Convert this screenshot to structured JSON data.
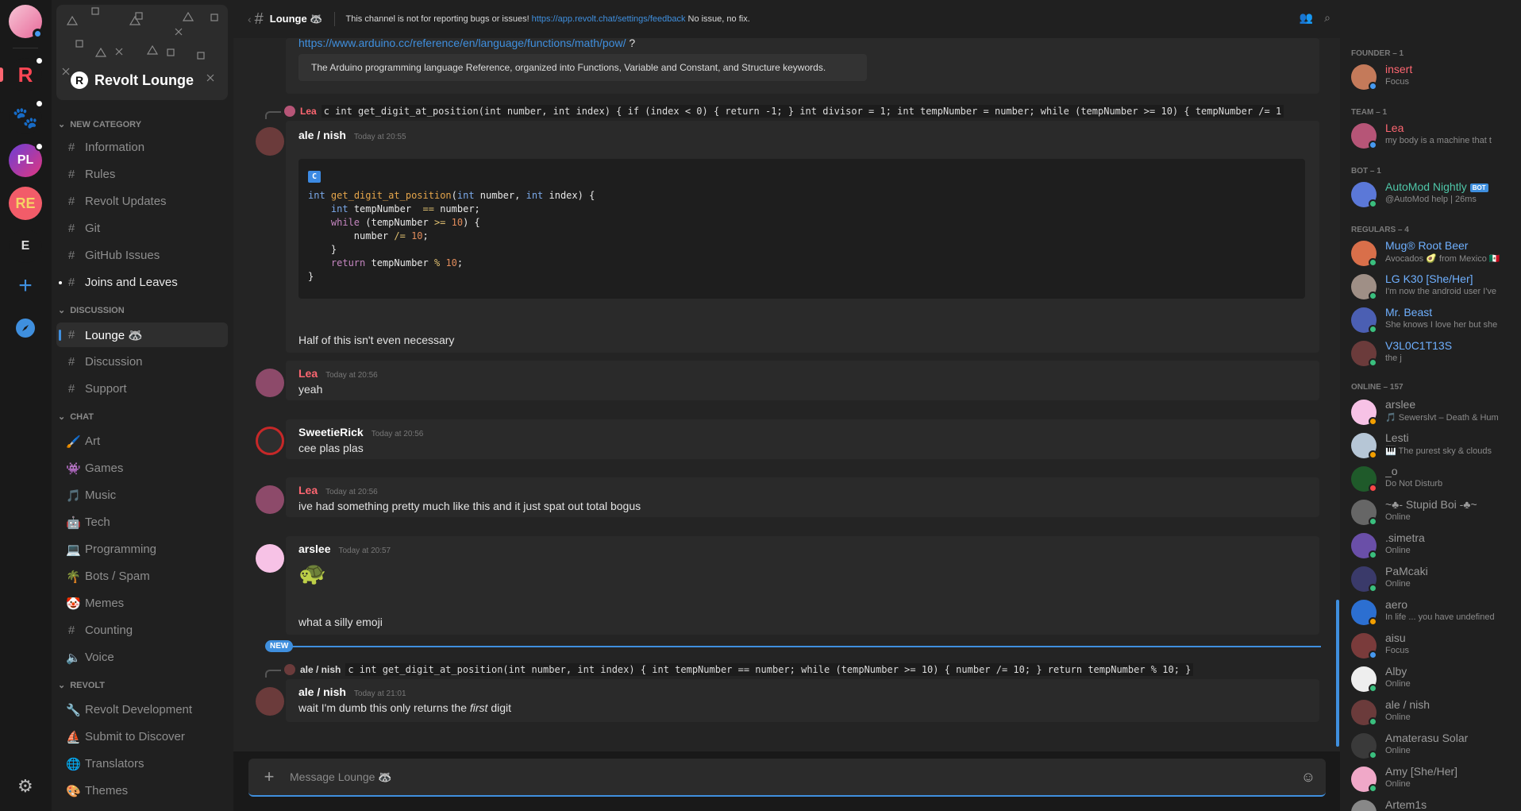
{
  "colors": {
    "accent": "#3f8fde",
    "danger": "#fd6671",
    "online": "#3abf7e",
    "idle": "#f39f00",
    "dnd": "#f84848",
    "focus": "#4799f0"
  },
  "servers": [
    {
      "name": "user-avatar",
      "letter": ""
    },
    {
      "name": "revolt",
      "letter": "R"
    },
    {
      "name": "paw",
      "letter": "🐾"
    },
    {
      "name": "pl",
      "letter": "PL"
    },
    {
      "name": "re",
      "letter": "RE"
    },
    {
      "name": "e",
      "letter": "E"
    }
  ],
  "sidebar": {
    "server_name": "Revolt Lounge",
    "categories": [
      {
        "label": "NEW CATEGORY"
      },
      {
        "label": "DISCUSSION"
      },
      {
        "label": "CHAT"
      },
      {
        "label": "REVOLT"
      }
    ],
    "channels": [
      {
        "label": "Information",
        "icon": "#"
      },
      {
        "label": "Rules",
        "icon": "#"
      },
      {
        "label": "Revolt Updates",
        "icon": "#"
      },
      {
        "label": "Git",
        "icon": "#"
      },
      {
        "label": "GitHub Issues",
        "icon": "#"
      },
      {
        "label": "Joins and Leaves",
        "icon": "#"
      },
      {
        "label": "Lounge 🦝",
        "icon": "#"
      },
      {
        "label": "Discussion",
        "icon": "#"
      },
      {
        "label": "Support",
        "icon": "#"
      },
      {
        "label": "Art",
        "icon": "🖌️"
      },
      {
        "label": "Games",
        "icon": "👾"
      },
      {
        "label": "Music",
        "icon": "🎵"
      },
      {
        "label": "Tech",
        "icon": "🤖"
      },
      {
        "label": "Programming",
        "icon": "💻"
      },
      {
        "label": "Bots / Spam",
        "icon": "🌴"
      },
      {
        "label": "Memes",
        "icon": "🤡"
      },
      {
        "label": "Counting",
        "icon": "#"
      },
      {
        "label": "Voice",
        "icon": "🔈"
      },
      {
        "label": "Revolt Development",
        "icon": "🔧"
      },
      {
        "label": "Submit to Discover",
        "icon": "⛵"
      },
      {
        "label": "Translators",
        "icon": "🌐"
      },
      {
        "label": "Themes",
        "icon": "🎨"
      }
    ]
  },
  "header": {
    "title": "Lounge 🦝",
    "desc_before": "This channel is not for reporting bugs or issues!",
    "link": "https://app.revolt.chat/settings/feedback",
    "desc_after": "No issue, no fix."
  },
  "messages": {
    "link": "https://www.arduino.cc/reference/en/language/functions/math/pow/",
    "link_suffix": "?",
    "embed": "The Arduino programming language Reference, organized into Functions, Variable and Constant, and Structure keywords.",
    "reply1_author": "Lea",
    "reply1_text": "c int get_digit_at_position(int number, int index) { if (index < 0) { return -1; } int divisor = 1; int tempNumber = number; while (tempNumber >= 10) { tempNumber /= 1",
    "m1_author": "ale / nish",
    "m1_time": "Today at 20:55",
    "code_lang": "C",
    "m1_followup": "Half of this isn't even necessary",
    "m2_author": "Lea",
    "m2_time": "Today at 20:56",
    "m2_text": "yeah",
    "m3_author": "SweetieRick",
    "m3_time": "Today at 20:56",
    "m3_text": "cee plas plas",
    "m4_author": "Lea",
    "m4_time": "Today at 20:56",
    "m4_text": "ive had something pretty much like this and it just spat out total bogus",
    "m5_author": "arslee",
    "m5_time": "Today at 20:57",
    "m5_emoji": "🐢",
    "m5_followup": "what a silly emoji",
    "new_label": "NEW",
    "reply2_author": "ale / nish",
    "reply2_text": "c int get_digit_at_position(int number, int index) { int tempNumber == number; while (tempNumber >= 10) { number /= 10; } return tempNumber % 10; }",
    "m6_author": "ale / nish",
    "m6_time": "Today at 21:01",
    "m6_before": "wait I'm dumb this only returns the",
    "m6_em": "first",
    "m6_after": "digit"
  },
  "composer": {
    "placeholder": "Message Lounge 🦝"
  },
  "members": {
    "groups": [
      {
        "label": "FOUNDER – 1"
      },
      {
        "label": "TEAM – 1"
      },
      {
        "label": "BOT – 1"
      },
      {
        "label": "REGULARS – 4"
      },
      {
        "label": "ONLINE – 157"
      }
    ],
    "list": [
      {
        "name": "insert",
        "status": "Focus",
        "color": "#fd6671"
      },
      {
        "name": "Lea",
        "status": "my body is a machine that t",
        "color": "#fd6671"
      },
      {
        "name": "AutoMod Nightly",
        "status": "@AutoMod help | 26ms",
        "color": "#4fc6a8",
        "bot": "BOT"
      },
      {
        "name": "Mug® Root Beer",
        "status": "Avocados 🥑 from Mexico 🇲🇽",
        "color": "#6fb0ff"
      },
      {
        "name": "LG K30 [She/Her]",
        "status": "I'm now the android user I've",
        "color": "#6fb0ff"
      },
      {
        "name": "Mr. Beast",
        "status": "She knows I love her but she",
        "color": "#6fb0ff"
      },
      {
        "name": "V3L0C1T13S",
        "status": "the j",
        "color": "#6fb0ff"
      },
      {
        "name": "arslee",
        "status": "🎵 Sewerslvt – Death & Hum",
        "color": "#9a9a9a"
      },
      {
        "name": "Lesti",
        "status": "🎹 The purest sky & clouds",
        "color": "#9a9a9a"
      },
      {
        "name": "_o",
        "status": "Do Not Disturb",
        "color": "#9a9a9a"
      },
      {
        "name": "~♣- Stupid Boi -♣~",
        "status": "Online",
        "color": "#9a9a9a"
      },
      {
        "name": ".simetra",
        "status": "Online",
        "color": "#9a9a9a"
      },
      {
        "name": "PaMcaki",
        "status": "Online",
        "color": "#9a9a9a"
      },
      {
        "name": "aero",
        "status": "In life ... you have undefined",
        "color": "#9a9a9a"
      },
      {
        "name": "aisu",
        "status": "Focus",
        "color": "#9a9a9a"
      },
      {
        "name": "Alby",
        "status": "Online",
        "color": "#9a9a9a"
      },
      {
        "name": "ale / nish",
        "status": "Online",
        "color": "#9a9a9a"
      },
      {
        "name": "Amaterasu Solar",
        "status": "Online",
        "color": "#9a9a9a"
      },
      {
        "name": "Amy [She/Her]",
        "status": "Online",
        "color": "#9a9a9a"
      },
      {
        "name": "Artem1s",
        "status": "",
        "color": "#9a9a9a"
      }
    ]
  }
}
